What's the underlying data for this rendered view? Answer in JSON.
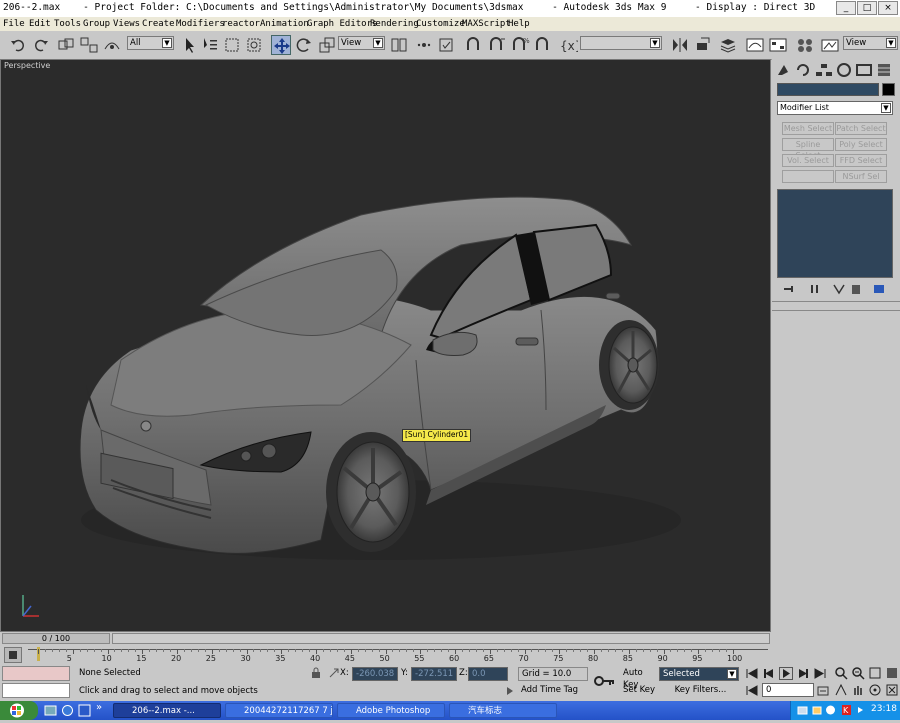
{
  "window": {
    "title": "206--2.max    - Project Folder: C:\\Documents and Settings\\Administrator\\My Documents\\3dsmax     - Autodesk 3ds Max 9     - Display : Direct 3D"
  },
  "menu": [
    "File",
    "Edit",
    "Tools",
    "Group",
    "Views",
    "Create",
    "Modifiers",
    "reactor",
    "Animation",
    "Graph Editors",
    "Rendering",
    "Customize",
    "MAXScript",
    "Help"
  ],
  "toolbar": {
    "selection_filter": "All",
    "ref_coord": "View",
    "named_selection": "",
    "render_view": "View"
  },
  "viewport": {
    "label": "Perspective",
    "tooltip": "[Sun] Cylinder01"
  },
  "command_panel": {
    "object_name": "",
    "modifier_list": "Modifier List",
    "modifier_buttons": [
      "Mesh Select",
      "Patch Select",
      "Spline Select",
      "Poly Select",
      "Vol. Select",
      "FFD Select",
      "",
      "NSurf Sel"
    ]
  },
  "timeline": {
    "frame_label": "0 / 100",
    "ticks": [
      "0",
      "5",
      "10",
      "15",
      "20",
      "25",
      "30",
      "35",
      "40",
      "45",
      "50",
      "55",
      "60",
      "65",
      "70",
      "75",
      "80",
      "85",
      "90",
      "95",
      "100"
    ]
  },
  "status": {
    "selection": "None Selected",
    "prompt": "Click and drag to select and move objects",
    "x_label": "X:",
    "x_value": "-260.038",
    "y_label": "Y:",
    "y_value": "-272.511",
    "z_label": "Z:",
    "z_value": "0.0",
    "grid": "Grid = 10.0",
    "add_time_tag": "Add Time Tag",
    "auto_key": "Auto Key",
    "set_key": "Set Key",
    "key_mode": "Selected",
    "key_filters": "Key Filters...",
    "current_frame": "0"
  },
  "taskbar": {
    "tasks": [
      "206--2.max        -...",
      "20044272117267 7 j...",
      "Adobe Photoshop",
      "汽车标志"
    ],
    "clock": "23:18"
  }
}
